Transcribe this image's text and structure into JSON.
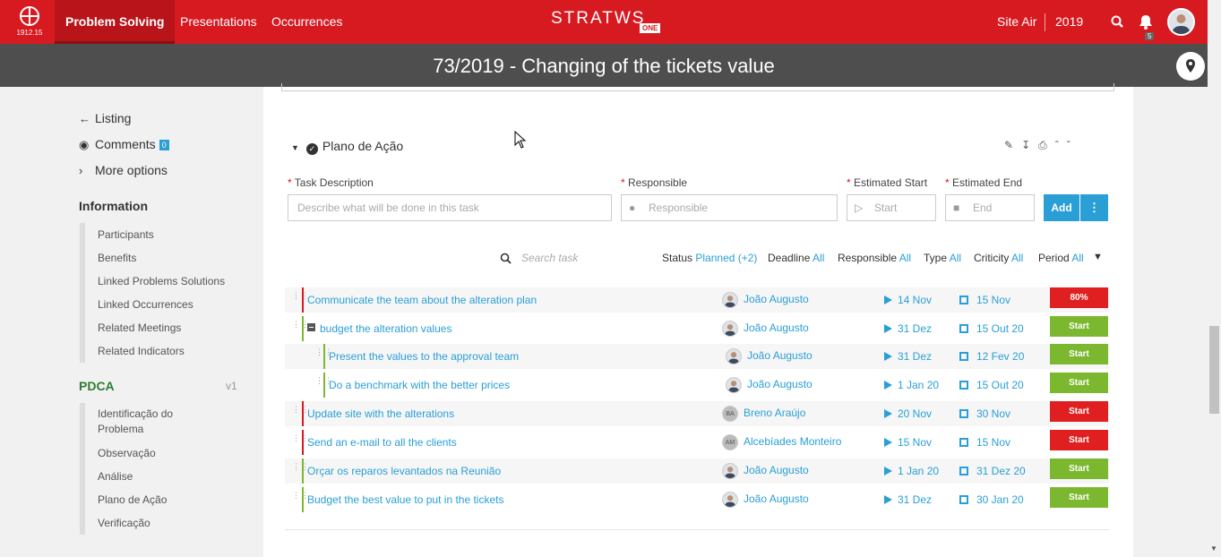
{
  "header": {
    "logo_version": "1912.15",
    "nav": [
      "Problem Solving",
      "Presentations",
      "Occurrences"
    ],
    "brand": "STRATWS",
    "brand_suffix": "ONE",
    "site": "Site Air",
    "year": "2019",
    "notifications": "5"
  },
  "page": {
    "title": "73/2019 - Changing of the tickets value"
  },
  "sidebar": {
    "links": [
      {
        "label": "Listing",
        "icon": "arrow-left-icon"
      },
      {
        "label": "Comments",
        "icon": "comments-icon",
        "badge": "0"
      },
      {
        "label": "More options",
        "icon": "chevron-right-icon"
      }
    ],
    "information_title": "Information",
    "information_items": [
      "Participants",
      "Benefits",
      "Linked Problems Solutions",
      "Linked Occurrences",
      "Related Meetings",
      "Related Indicators"
    ],
    "pdca_title": "PDCA",
    "pdca_version": "v1",
    "pdca_items": [
      "Identificação do Problema",
      "Observação",
      "Análise",
      "Plano de Ação",
      "Verificação"
    ]
  },
  "section": {
    "title": "Plano de Ação"
  },
  "form": {
    "task_label": "Task Description",
    "task_placeholder": "Describe what will be done in this task",
    "responsible_label": "Responsible",
    "responsible_placeholder": "Responsible",
    "start_label": "Estimated Start",
    "start_placeholder": "Start",
    "end_label": "Estimated End",
    "end_placeholder": "End",
    "add_label": "Add"
  },
  "filters": {
    "search_placeholder": "Search task",
    "status_label": "Status",
    "status_value": "Planned (+2)",
    "deadline_label": "Deadline",
    "deadline_value": "All",
    "responsible_label": "Responsible",
    "responsible_value": "All",
    "type_label": "Type",
    "type_value": "All",
    "criticity_label": "Criticity",
    "criticity_value": "All",
    "period_label": "Period",
    "period_value": "All"
  },
  "tasks": [
    {
      "text": "Communicate the team about the alteration plan",
      "responsible": "João Augusto",
      "initials": "",
      "start": "14 Nov",
      "end": "15 Nov",
      "status": "80%",
      "status_color": "#e02020",
      "bar_color": "#d71920"
    },
    {
      "text": "budget the alteration values",
      "responsible": "João Augusto",
      "initials": "",
      "start": "31 Dez",
      "end": "15 Out 20",
      "status": "Start",
      "status_color": "#7cb82f",
      "bar_color": "#7cb82f"
    },
    {
      "text": "Present the values to the approval team",
      "responsible": "João Augusto",
      "initials": "",
      "start": "31 Dez",
      "end": "12 Fev 20",
      "status": "Start",
      "status_color": "#7cb82f",
      "bar_color": "#7cb82f"
    },
    {
      "text": "Do a benchmark with the better prices",
      "responsible": "João Augusto",
      "initials": "",
      "start": "1 Jan 20",
      "end": "15 Out 20",
      "status": "Start",
      "status_color": "#7cb82f",
      "bar_color": "#7cb82f"
    },
    {
      "text": "Update site with the alterations",
      "responsible": "Breno Araújo",
      "initials": "BA",
      "start": "20 Nov",
      "end": "30 Nov",
      "status": "Start",
      "status_color": "#e02020",
      "bar_color": "#d71920"
    },
    {
      "text": "Send an e-mail to all the clients",
      "responsible": "Alcebíades Monteiro",
      "initials": "AM",
      "start": "15 Nov",
      "end": "15 Nov",
      "status": "Start",
      "status_color": "#e02020",
      "bar_color": "#d71920"
    },
    {
      "text": "Orçar os reparos levantados na Reunião",
      "responsible": "João Augusto",
      "initials": "",
      "start": "1 Jan 20",
      "end": "31 Dez 20",
      "status": "Start",
      "status_color": "#7cb82f",
      "bar_color": "#7cb82f"
    },
    {
      "text": "Budget the best value to put in the tickets",
      "responsible": "João Augusto",
      "initials": "",
      "start": "31 Dez",
      "end": "30 Jan 20",
      "status": "Start",
      "status_color": "#7cb82f",
      "bar_color": "#7cb82f"
    }
  ]
}
